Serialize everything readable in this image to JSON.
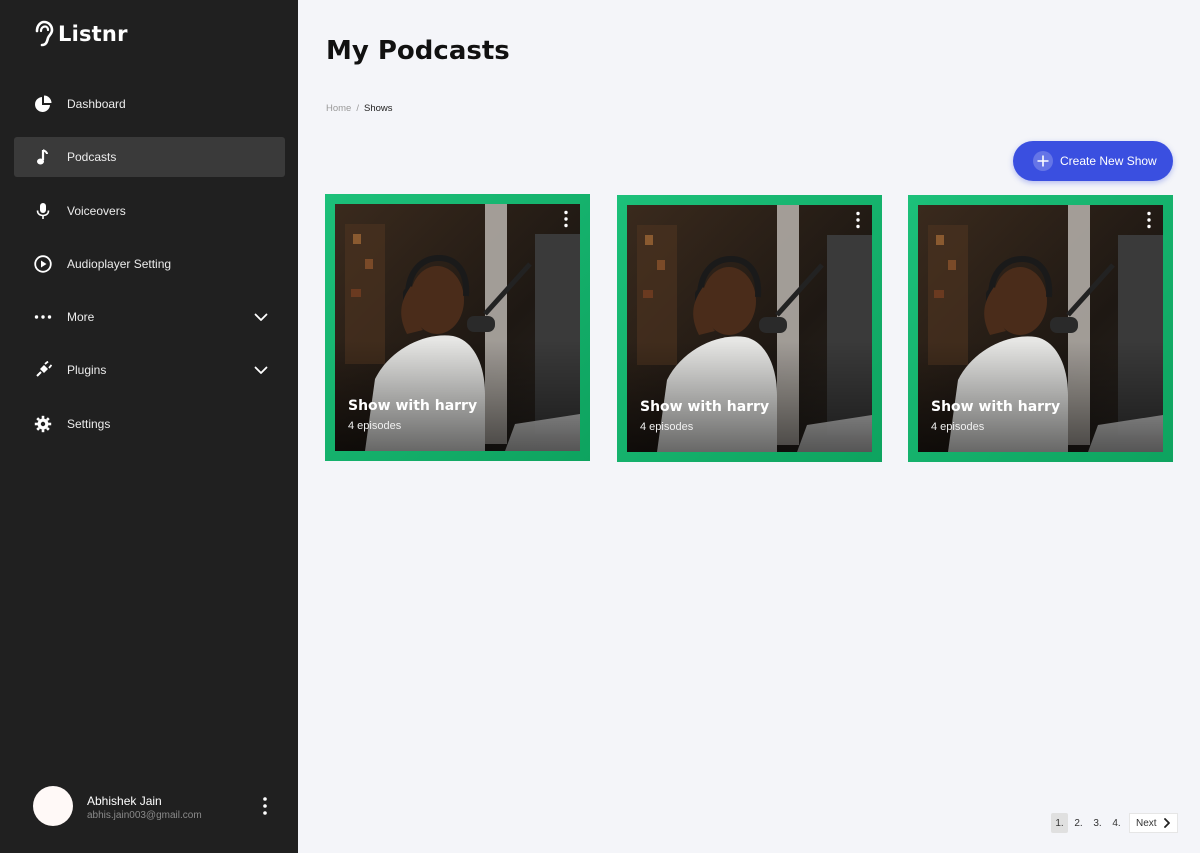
{
  "brand": {
    "name": "Listnr"
  },
  "sidebar": {
    "items": [
      {
        "label": "Dashboard",
        "icon": "pie-chart-icon",
        "active": false,
        "expandable": false
      },
      {
        "label": "Podcasts",
        "icon": "music-note-icon",
        "active": true,
        "expandable": false
      },
      {
        "label": "Voiceovers",
        "icon": "microphone-icon",
        "active": false,
        "expandable": false
      },
      {
        "label": "Audioplayer Setting",
        "icon": "play-circle-icon",
        "active": false,
        "expandable": false
      },
      {
        "label": "More",
        "icon": "more-dots-icon",
        "active": false,
        "expandable": true
      },
      {
        "label": "Plugins",
        "icon": "plugin-icon",
        "active": false,
        "expandable": true
      },
      {
        "label": "Settings",
        "icon": "gear-icon",
        "active": false,
        "expandable": false
      }
    ]
  },
  "user": {
    "name": "Abhishek Jain",
    "email": "abhis.jain003@gmail.com"
  },
  "header": {
    "title": "My Podcasts"
  },
  "breadcrumb": {
    "home": "Home",
    "separator": "/",
    "current": "Shows"
  },
  "actions": {
    "create_label": "Create New Show"
  },
  "shows": [
    {
      "title": "Show with harry",
      "episodes": "4 episodes"
    },
    {
      "title": "Show with harry",
      "episodes": "4 episodes"
    },
    {
      "title": "Show with harry",
      "episodes": "4 episodes"
    }
  ],
  "pagination": {
    "pages": [
      "1.",
      "2.",
      "3.",
      "4."
    ],
    "current": "1.",
    "next_label": "Next"
  },
  "colors": {
    "sidebar_bg": "#202020",
    "accent_blue": "#3a4fe0",
    "card_green": "#17b36c",
    "page_bg": "#f4f5f9"
  }
}
